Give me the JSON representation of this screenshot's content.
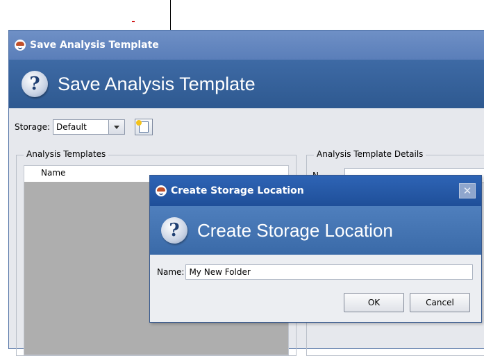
{
  "main_window": {
    "title": "Save Analysis Template",
    "header_title": "Save Analysis Template",
    "storage": {
      "label": "Storage:",
      "selected": "Default"
    },
    "templates_group": {
      "legend": "Analysis Templates",
      "column_header": "Name"
    },
    "details_group": {
      "legend": "Analysis Template Details",
      "name_label": "N"
    }
  },
  "dialog": {
    "title": "Create Storage Location",
    "header_title": "Create Storage Location",
    "name_label": "Name:",
    "name_value": "My New Folder",
    "ok_label": "OK",
    "cancel_label": "Cancel",
    "close_glyph": "✕"
  },
  "icons": {
    "app": "app-logo-icon",
    "help": "help-icon",
    "new_folder": "new-folder-icon",
    "dropdown": "chevron-down-icon",
    "close": "close-icon"
  },
  "colors": {
    "titlebar": "#5a7eb9",
    "header_band": "#2e5990",
    "dialog_titlebar": "#1f4f99",
    "list_body": "#aeaeae",
    "callout_accent": "#d21a1a"
  }
}
